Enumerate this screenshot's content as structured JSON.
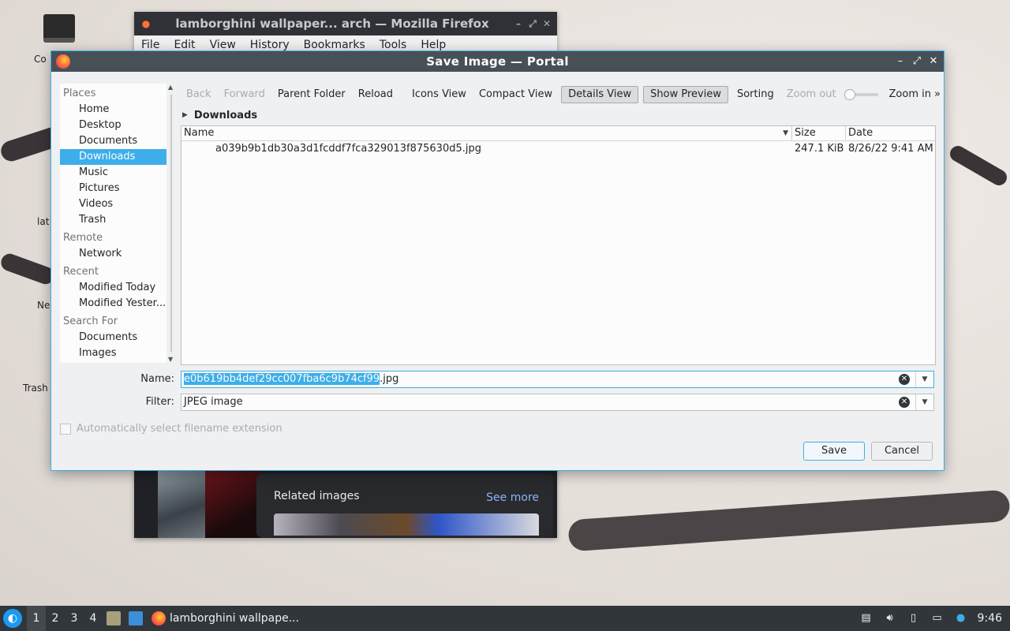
{
  "desktop": {
    "icons": [
      {
        "label": "Co"
      },
      {
        "label": "lat"
      },
      {
        "label": "Ne"
      },
      {
        "label": "Trash"
      }
    ]
  },
  "firefox": {
    "title": "lamborghini wallpaper... arch — Mozilla Firefox",
    "menu": [
      "File",
      "Edit",
      "View",
      "History",
      "Bookmarks",
      "Tools",
      "Help"
    ],
    "related_title": "Related images",
    "see_more": "See more"
  },
  "dialog": {
    "title": "Save Image — Portal",
    "places": [
      {
        "type": "section",
        "label": "Places"
      },
      {
        "type": "item",
        "label": "Home",
        "name": "home"
      },
      {
        "type": "item",
        "label": "Desktop",
        "name": "desktop"
      },
      {
        "type": "item",
        "label": "Documents",
        "name": "documents"
      },
      {
        "type": "item",
        "label": "Downloads",
        "name": "downloads",
        "selected": true
      },
      {
        "type": "item",
        "label": "Music",
        "name": "music"
      },
      {
        "type": "item",
        "label": "Pictures",
        "name": "pictures"
      },
      {
        "type": "item",
        "label": "Videos",
        "name": "videos"
      },
      {
        "type": "item",
        "label": "Trash",
        "name": "trash"
      },
      {
        "type": "section",
        "label": "Remote"
      },
      {
        "type": "item",
        "label": "Network",
        "name": "network"
      },
      {
        "type": "section",
        "label": "Recent"
      },
      {
        "type": "item",
        "label": "Modified Today",
        "name": "modified-today"
      },
      {
        "type": "item",
        "label": "Modified Yester...",
        "name": "modified-yesterday"
      },
      {
        "type": "section",
        "label": "Search For"
      },
      {
        "type": "item",
        "label": "Documents",
        "name": "search-documents"
      },
      {
        "type": "item",
        "label": "Images",
        "name": "search-images"
      }
    ],
    "toolbar": {
      "back": "Back",
      "forward": "Forward",
      "parent": "Parent Folder",
      "reload": "Reload",
      "icons_view": "Icons View",
      "compact_view": "Compact View",
      "details_view": "Details View",
      "show_preview": "Show Preview",
      "sorting": "Sorting",
      "zoom_out": "Zoom out",
      "zoom_in": "Zoom in",
      "more": "»"
    },
    "breadcrumb": "Downloads",
    "columns": {
      "name": "Name",
      "size": "Size",
      "date": "Date"
    },
    "files": [
      {
        "name": "a039b9b1db30a3d1fcddf7fca329013f875630d5.jpg",
        "size": "247.1 KiB",
        "date": "8/26/22 9:41 AM"
      }
    ],
    "name_label": "Name:",
    "name_selected": "e0b619bb4def29cc007fba6c9b74cf99",
    "name_ext": ".jpg",
    "filter_label": "Filter:",
    "filter_value": "JPEG image",
    "auto_ext": "Automatically select filename extension",
    "save": "Save",
    "cancel": "Cancel"
  },
  "taskbar": {
    "workspaces": [
      "1",
      "2",
      "3",
      "4"
    ],
    "task_label": "lamborghini wallpape...",
    "clock": "9:46"
  }
}
